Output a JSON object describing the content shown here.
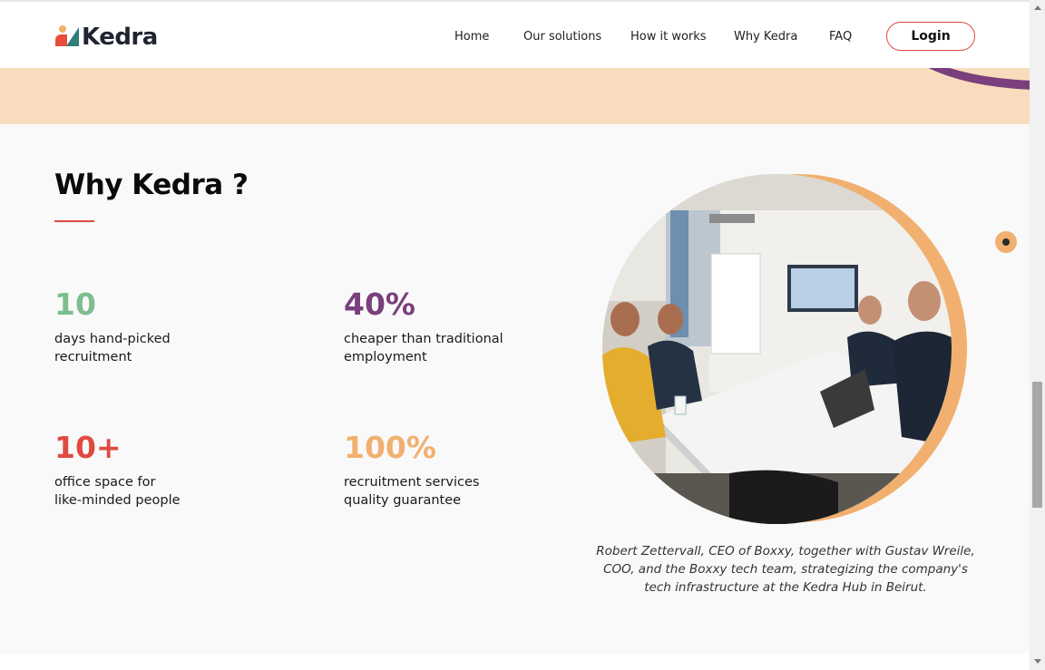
{
  "header": {
    "logo_text": "Kedra",
    "nav": [
      {
        "label": "Home"
      },
      {
        "label": "Our solutions"
      },
      {
        "label": "How it works"
      },
      {
        "label": "Why Kedra"
      },
      {
        "label": "FAQ"
      }
    ],
    "login_label": "Login"
  },
  "section": {
    "title": "Why Kedra ?",
    "stats": [
      {
        "number": "10",
        "line1": "days hand-picked",
        "line2": "recruitment",
        "color": "#7dbd8f"
      },
      {
        "number": "40%",
        "line1": "cheaper than traditional",
        "line2": "employment",
        "color": "#7a3f7c"
      },
      {
        "number": "10+",
        "line1": "office space for",
        "line2": "like-minded people",
        "color": "#e04b40"
      },
      {
        "number": "100%",
        "line1": "recruitment services",
        "line2": "quality guarantee",
        "color": "#f1b06f"
      }
    ],
    "caption": "Robert Zettervall, CEO of Boxxy, together with Gustav Wreile, COO, and the Boxxy tech team, strategizing the company's tech infrastructure at the Kedra Hub in Beirut."
  },
  "colors": {
    "accent_red": "#e04b40",
    "peach": "#f8dcbd",
    "purple": "#7a3f7c",
    "orange": "#f1b06f",
    "green": "#7dbd8f"
  },
  "icons": {
    "logo": "kedra-logo-icon",
    "floating": "scroll-indicator-dot-icon"
  }
}
